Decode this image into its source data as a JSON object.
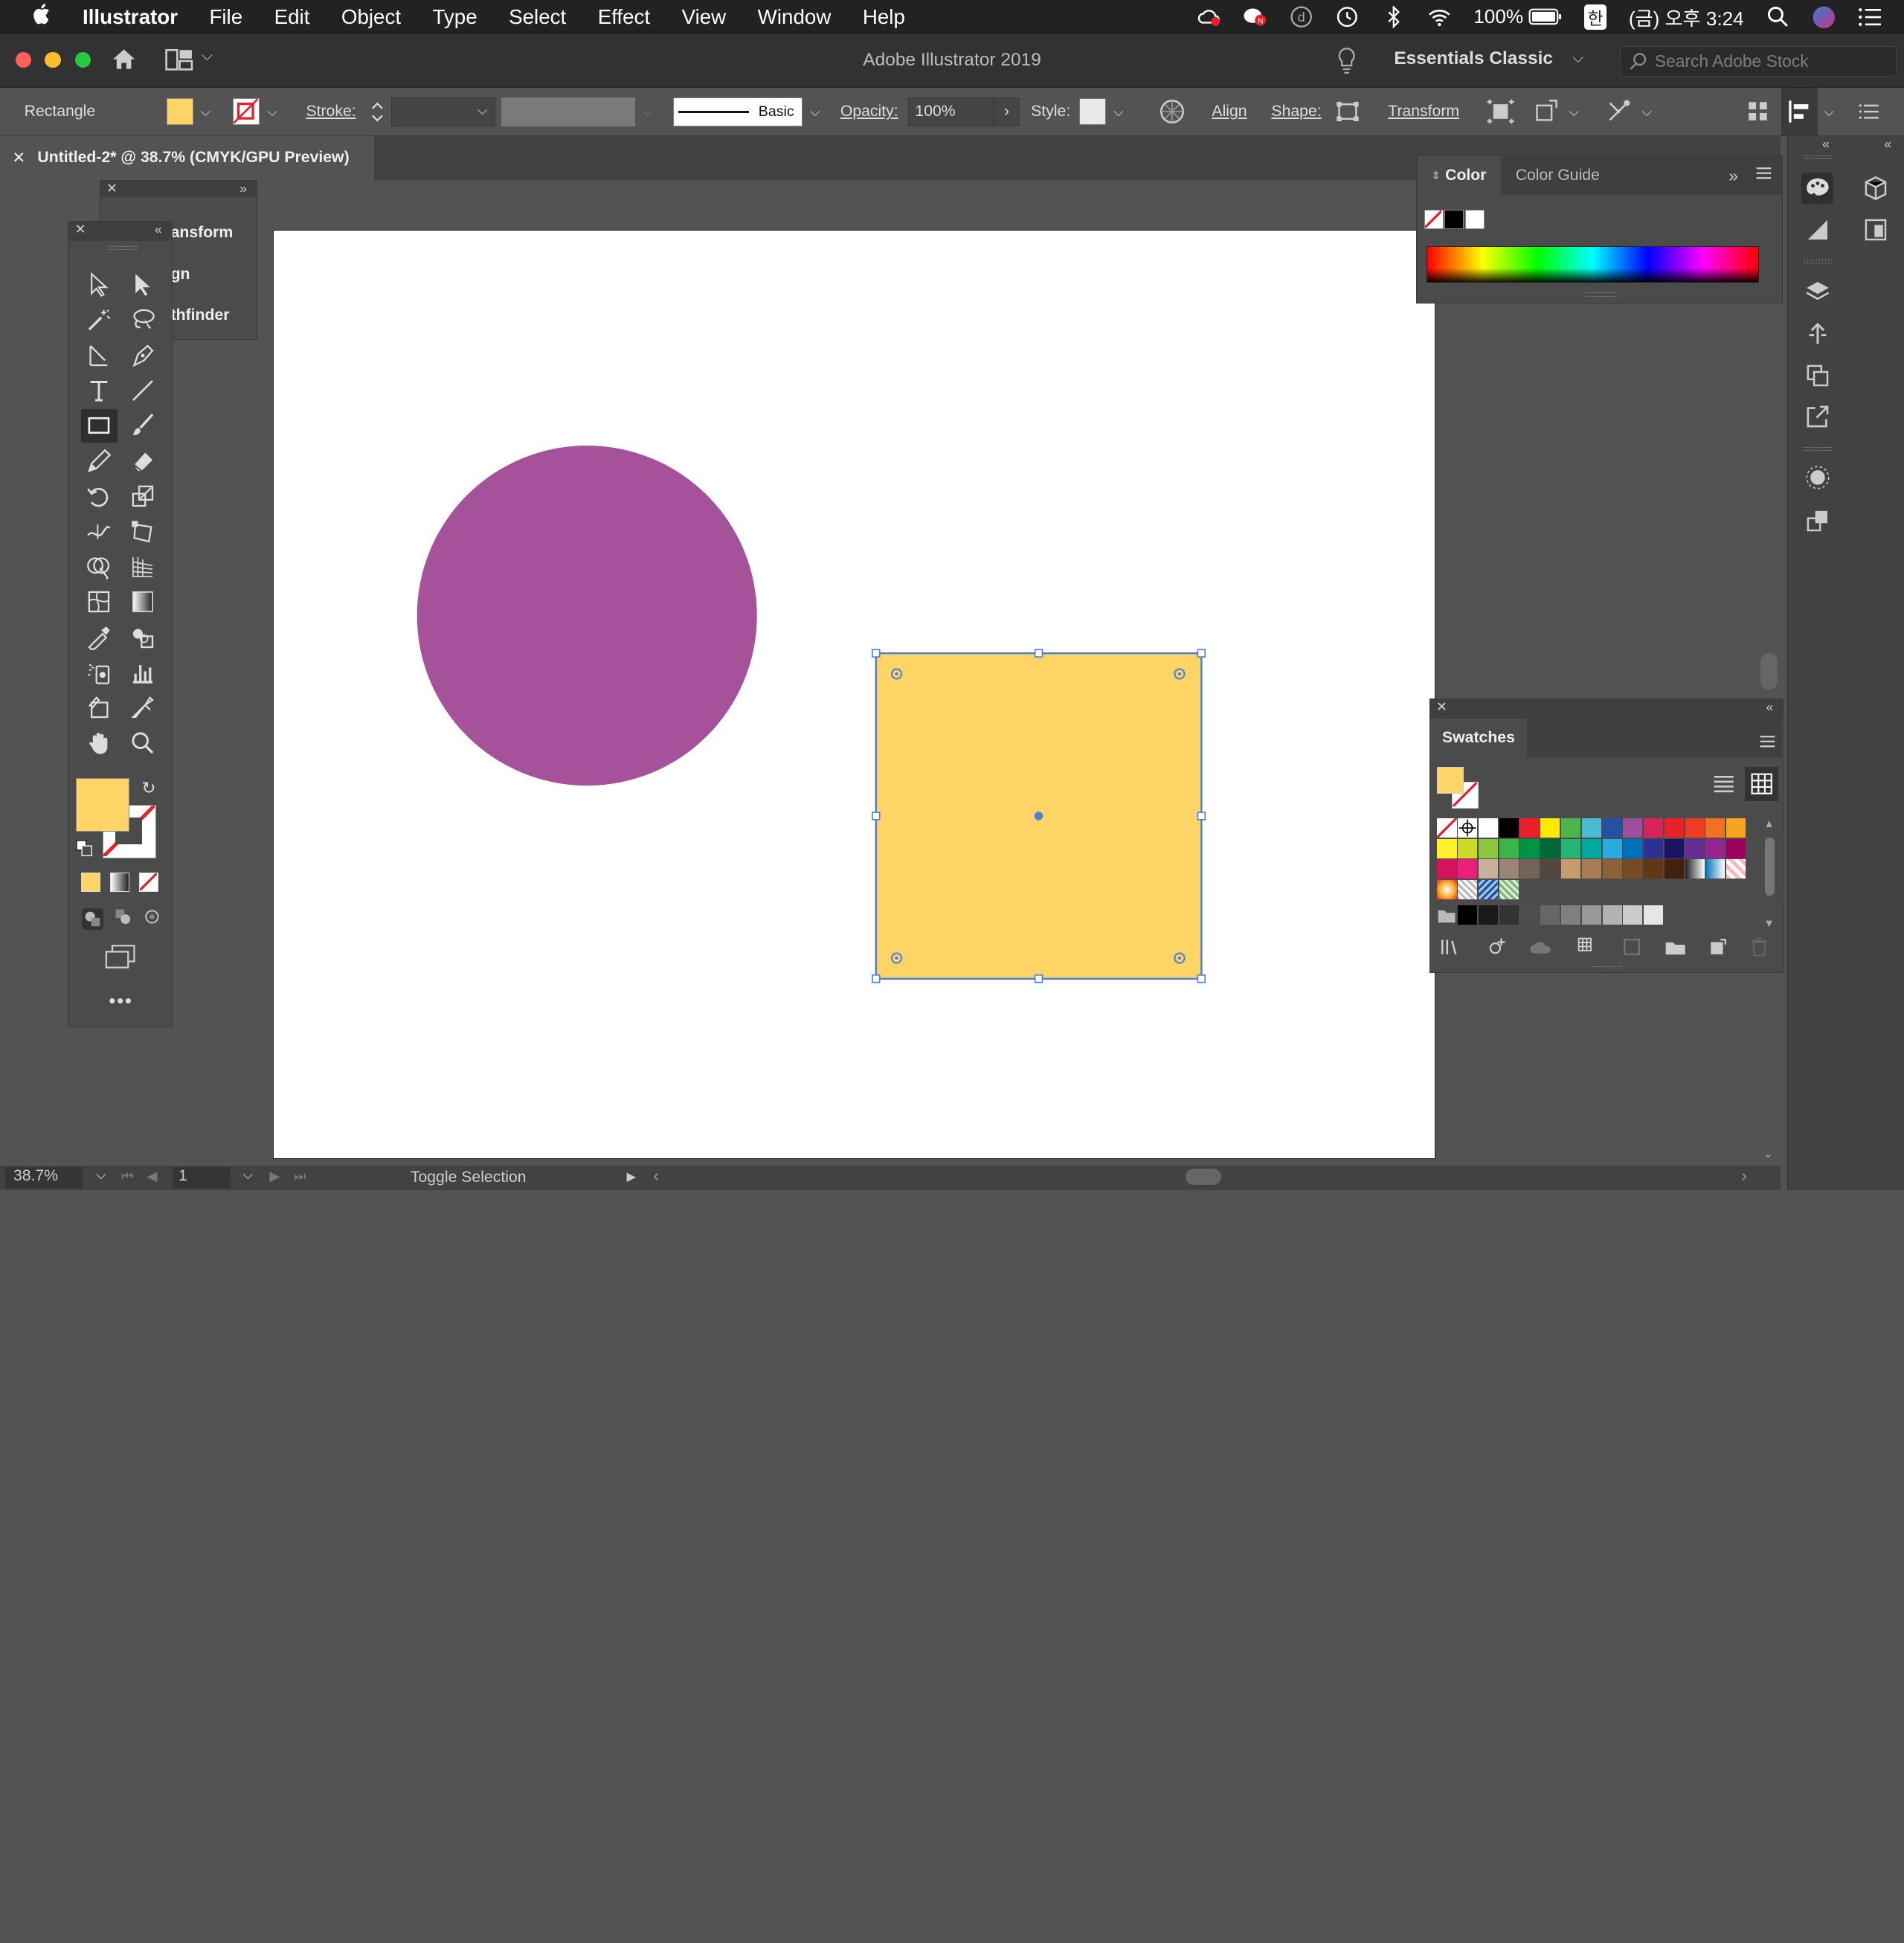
{
  "menubar": {
    "app_name": "Illustrator",
    "items": [
      "File",
      "Edit",
      "Object",
      "Type",
      "Select",
      "Effect",
      "View",
      "Window",
      "Help"
    ],
    "battery": "100%",
    "input_method": "한",
    "clock": "(금) 오후 3:24"
  },
  "titlebar": {
    "title": "Adobe Illustrator 2019",
    "workspace": "Essentials Classic",
    "search_placeholder": "Search Adobe Stock"
  },
  "controlbar": {
    "selection_type": "Rectangle",
    "stroke_label": "Stroke:",
    "brush_label": "Basic",
    "opacity_label": "Opacity:",
    "opacity_value": "100%",
    "style_label": "Style:",
    "align_label": "Align",
    "shape_label": "Shape:",
    "transform_label": "Transform"
  },
  "document": {
    "tab_title": "Untitled-2* @ 38.7% (CMYK/GPU Preview)"
  },
  "flyout": {
    "items": [
      "ansform",
      "gn",
      "thfinder"
    ]
  },
  "color_panel": {
    "tabs": [
      "Color",
      "Color Guide"
    ]
  },
  "swatches_panel": {
    "title": "Swatches"
  },
  "statusbar": {
    "zoom": "38.7%",
    "page": "1",
    "status_text": "Toggle Selection"
  },
  "colors": {
    "circle_fill": "#a5529a",
    "rect_fill": "#ffd466",
    "selection": "#4a7fe0",
    "swatch_rows": [
      [
        "none",
        "reg",
        "#ffffff",
        "#000000",
        "#e8202a",
        "#fde900",
        "#4cb648",
        "#4bbbd5",
        "#2651a3",
        "#9f4d9d",
        "#d6245b",
        "#e8202a",
        "#ee3d23",
        "#f37021",
        "#f7a31c"
      ],
      [
        "#fef12a",
        "#cbdb2a",
        "#8cc63f",
        "#39b54a",
        "#009245",
        "#006837",
        "#22b573",
        "#00a99d",
        "#29abe2",
        "#0071bc",
        "#2e3192",
        "#1b1464",
        "#662d91",
        "#93278f",
        "#9e005d"
      ],
      [
        "#d4145a",
        "#ed1e79",
        "#c7b299",
        "#998675",
        "#736357",
        "#534741",
        "#c69c6d",
        "#a67c52",
        "#8c6239",
        "#754c24",
        "#603813",
        "#42210b",
        "grad1",
        "grad2",
        "pat1"
      ],
      [
        "grad3",
        "pat2",
        "pat3",
        "pat4"
      ],
      [
        "folder",
        "#000000",
        "#1a1a1a",
        "#333333",
        "#4d4d4d",
        "#666666",
        "#808080",
        "#999999",
        "#b3b3b3",
        "#cccccc",
        "#e6e6e6"
      ]
    ]
  }
}
